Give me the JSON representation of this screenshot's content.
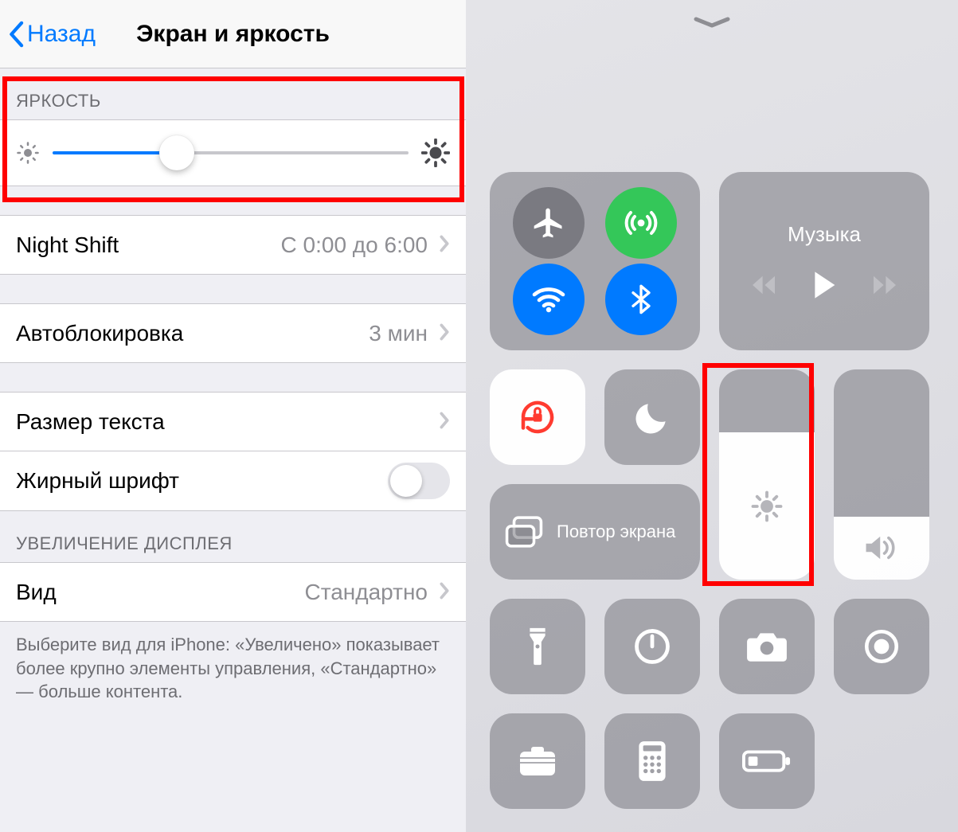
{
  "left": {
    "back_label": "Назад",
    "title": "Экран и яркость",
    "brightness": {
      "header": "ЯРКОСТЬ",
      "slider_percent": 35
    },
    "night_shift": {
      "label": "Night Shift",
      "value": "С 0:00 до 6:00"
    },
    "auto_lock": {
      "label": "Автоблокировка",
      "value": "3 мин"
    },
    "text_size": {
      "label": "Размер текста"
    },
    "bold_text": {
      "label": "Жирный шрифт",
      "enabled": false
    },
    "display_zoom": {
      "header": "УВЕЛИЧЕНИЕ ДИСПЛЕЯ",
      "view_label": "Вид",
      "view_value": "Стандартно",
      "footer": "Выберите вид для iPhone: «Увеличено» показывает более крупно элементы управления, «Стандартно» — больше контента."
    }
  },
  "right": {
    "music_label": "Музыка",
    "mirror_label": "Повтор экрана",
    "brightness_percent": 70,
    "volume_percent": 30,
    "connectivity": {
      "airplane": false,
      "cellular": true,
      "wifi": true,
      "bluetooth": true
    }
  },
  "colors": {
    "accent": "#007aff",
    "green": "#34c759",
    "tile_gray": "rgba(120,120,128,0.55)",
    "highlight": "#ff0000"
  }
}
